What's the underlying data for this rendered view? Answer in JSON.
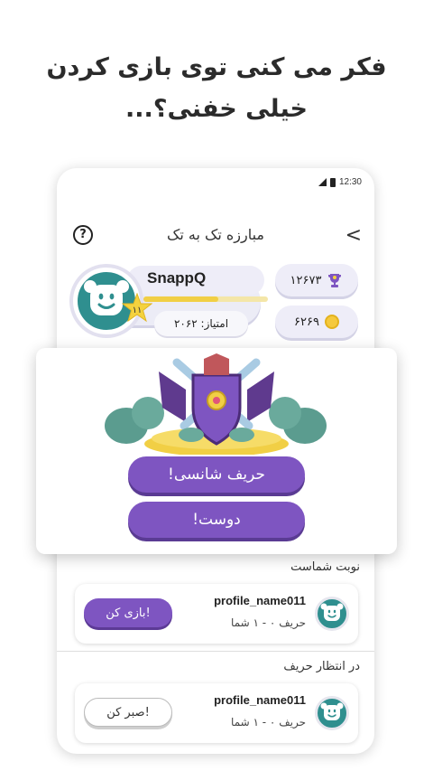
{
  "headline": {
    "line1": "فکر می کنی توی بازی کردن",
    "line2": "خیلی خفنی؟..."
  },
  "status_bar": {
    "time": "12:30"
  },
  "app_bar": {
    "title": "مبارزه تک به تک",
    "back_glyph": "<",
    "help_glyph": "?"
  },
  "profile": {
    "username": "SnappQ",
    "level": "۱۱",
    "score": "امتیاز: ۲۰۶۲",
    "xp_progress": 0.6
  },
  "stats": {
    "trophies": "۱۲۶۷۳",
    "coins": "۶۲۶۹"
  },
  "modal": {
    "random_opponent": "حریف شانسی!",
    "friend": "دوست!"
  },
  "sections": {
    "your_turn": "نوبت شماست",
    "waiting": "در انتظار حریف"
  },
  "matches": [
    {
      "name": "profile_name011",
      "score": "حریف ۰ - ۱ شما",
      "action": "بازی کن!"
    },
    {
      "name": "profile_name011",
      "score": "حریف ۰ - ۱ شما",
      "action": "صبر کن!"
    }
  ],
  "colors": {
    "accent_purple": "#7e55c1",
    "avatar_teal": "#2f8f8f",
    "gold": "#f1cf45"
  }
}
